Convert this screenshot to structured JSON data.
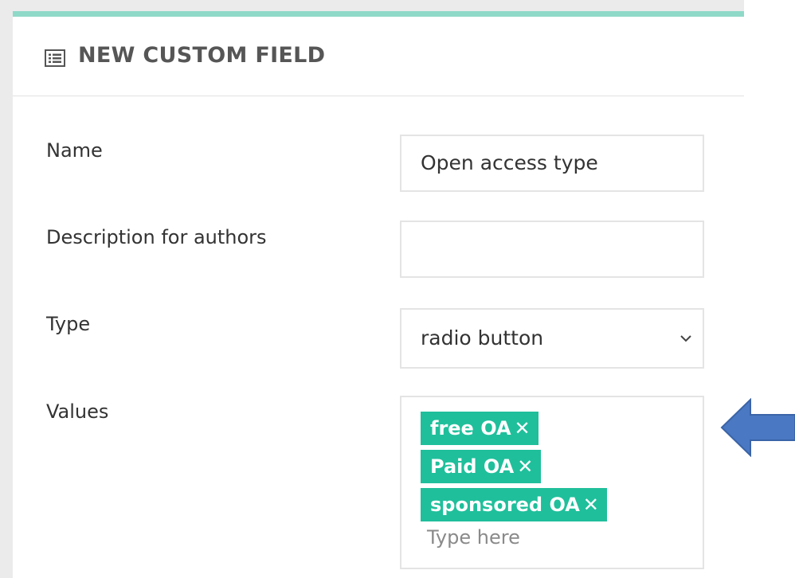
{
  "panel": {
    "title": "NEW CUSTOM FIELD",
    "accent_color": "#8fd9c8"
  },
  "form": {
    "name": {
      "label": "Name",
      "value": "Open access type"
    },
    "description": {
      "label": "Description for authors",
      "value": ""
    },
    "type": {
      "label": "Type",
      "selected": "radio button"
    },
    "values": {
      "label": "Values",
      "tags": [
        {
          "text": "free OA",
          "remove": "✕"
        },
        {
          "text": "Paid OA",
          "remove": "✕"
        },
        {
          "text": "sponsored OA",
          "remove": "✕"
        }
      ],
      "placeholder": "Type here",
      "tag_color": "#1fbf9b"
    }
  },
  "annotation": {
    "icon": "left-arrow-icon",
    "color": "#4a78c2"
  }
}
